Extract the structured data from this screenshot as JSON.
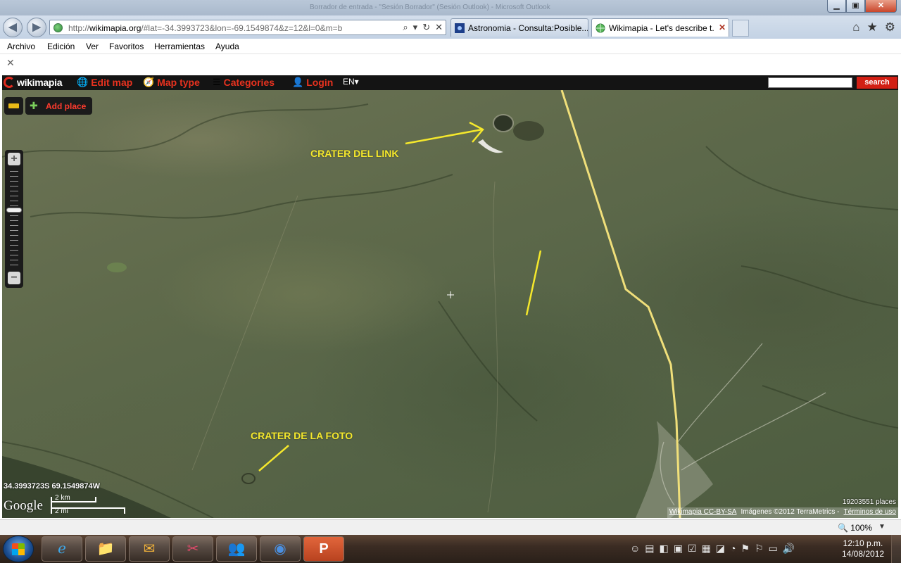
{
  "window": {
    "ghost_title": "Borrador de entrada - \"Sesión Borrador\" (Sesión Outlook) - Microsoft Outlook",
    "minimize": "▁",
    "maximize": "▣",
    "close": "✕"
  },
  "nav": {
    "back": "◀",
    "forward": "▶",
    "url_prefix": "http://",
    "url_host": "wikimapia.org",
    "url_rest": "/#lat=-34.3993723&lon=-69.1549874&z=12&l=0&m=b",
    "search_glyph": "⌕",
    "compat_glyph": "▾",
    "refresh_glyph": "↻",
    "stop_glyph": "✕"
  },
  "tabs": [
    {
      "label": "Astronomia - Consulta:Posible...",
      "close": "✕"
    },
    {
      "label": "Wikimapia - Let's describe t...",
      "close": "✕"
    }
  ],
  "browser_tools": {
    "home": "⌂",
    "favorites": "★",
    "settings": "⚙"
  },
  "menu": [
    "Archivo",
    "Edición",
    "Ver",
    "Favoritos",
    "Herramientas",
    "Ayuda"
  ],
  "favbar": {
    "close": "✕"
  },
  "wikimapia": {
    "logo": "wikimapia",
    "edit_map": "Edit map",
    "map_type": "Map type",
    "categories": "Categories",
    "login": "Login",
    "language": "EN▾",
    "search_button": "search",
    "search_value": ""
  },
  "map": {
    "add_place": "Add place",
    "zoom_in": "+",
    "zoom_out": "−",
    "zoom_level_fraction": 0.55,
    "annotation_top": "CRATER DEL LINK",
    "annotation_bottom": "CRATER DE LA FOTO",
    "coords": "34.3993723S 69.1549874W",
    "google_logo": "Google",
    "scale_km": "2 km",
    "scale_mi": "2 mi",
    "places_count": "19203551 places",
    "attribution_license": "Wikimapia CC-BY-SA",
    "attribution_imagery": "Imágenes ©2012 TerraMetrics -",
    "attribution_terms": "Términos de uso",
    "road_color": "#f0df7a",
    "annotation_color": "#f5e82c"
  },
  "statusbar": {
    "zoom": "🔍 100%",
    "dropdown": "▼"
  },
  "taskbar": {
    "apps": [
      {
        "name": "internet-explorer",
        "glyph": "ℯ"
      },
      {
        "name": "file-explorer",
        "glyph": "📁"
      },
      {
        "name": "outlook",
        "glyph": "✉"
      },
      {
        "name": "paint",
        "glyph": "✂"
      },
      {
        "name": "messenger",
        "glyph": "👥"
      },
      {
        "name": "google-earth",
        "glyph": "◉"
      },
      {
        "name": "powerpoint",
        "glyph": "P"
      }
    ],
    "tray_glyphs": [
      "☺",
      "▤",
      "◧",
      "▣",
      "☑",
      "▦",
      "◪",
      "◔",
      "⚑",
      "⚐",
      "▭",
      "🔊"
    ],
    "time": "12:10 p.m.",
    "date": "14/08/2012"
  }
}
